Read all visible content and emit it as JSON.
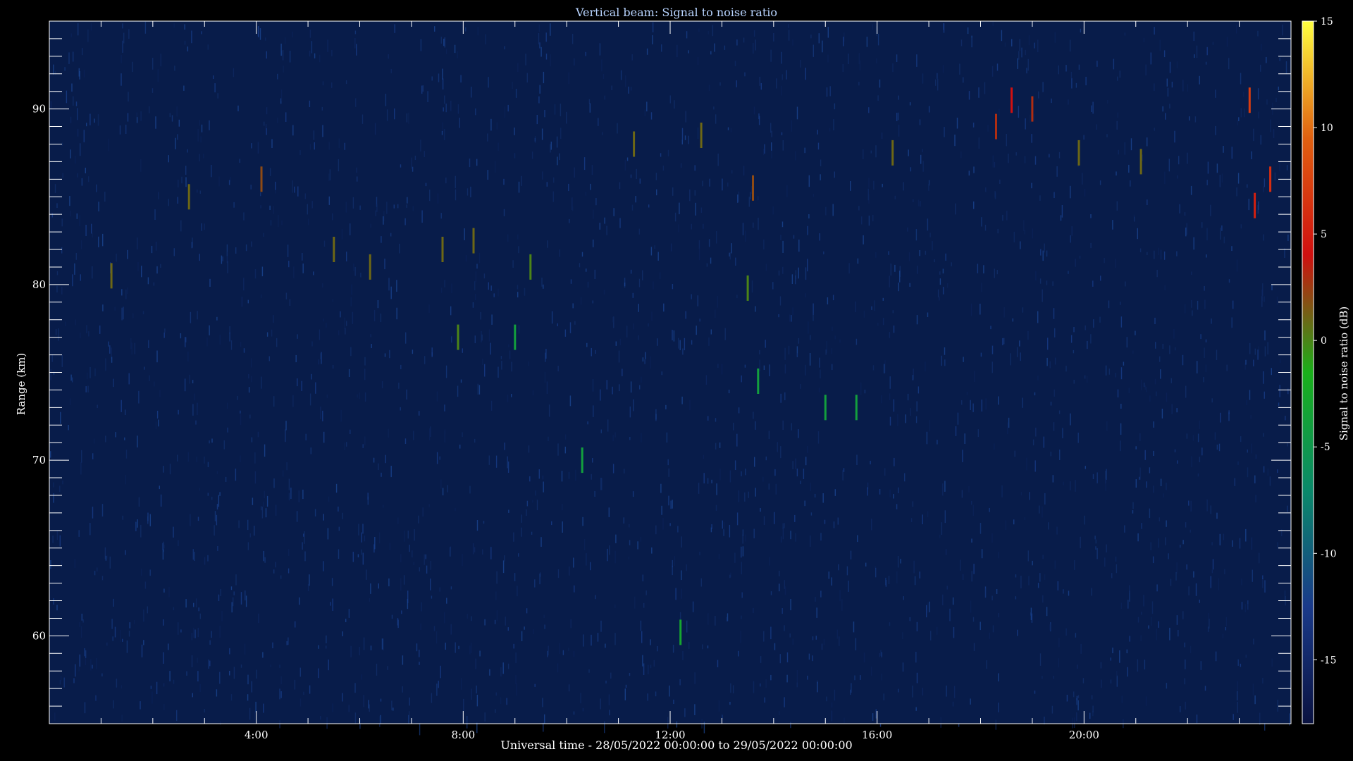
{
  "chart_data": {
    "type": "heatmap",
    "title": "Vertical beam: Signal to noise ratio",
    "xlabel": "Universal time - 28/05/2022 00:00:00 to 29/05/2022 00:00:00",
    "ylabel": "Range (km)",
    "colorbar_label": "Signal to noise ratio (dB)",
    "xlim_hours": [
      0,
      24
    ],
    "ylim_km": [
      55,
      95
    ],
    "clim_db": [
      -18,
      15
    ],
    "x_ticks": [
      {
        "hour": 4,
        "label": "4:00"
      },
      {
        "hour": 8,
        "label": "8:00"
      },
      {
        "hour": 12,
        "label": "12:00"
      },
      {
        "hour": 16,
        "label": "16:00"
      },
      {
        "hour": 20,
        "label": "20:00"
      }
    ],
    "y_ticks": [
      {
        "km": 60,
        "label": "60"
      },
      {
        "km": 70,
        "label": "70"
      },
      {
        "km": 80,
        "label": "80"
      },
      {
        "km": 90,
        "label": "90"
      }
    ],
    "colorbar_ticks": [
      {
        "db": 15,
        "label": "15"
      },
      {
        "db": 10,
        "label": "10"
      },
      {
        "db": 5,
        "label": "5"
      },
      {
        "db": 0,
        "label": "0"
      },
      {
        "db": -5,
        "label": "-5"
      },
      {
        "db": -10,
        "label": "-10"
      },
      {
        "db": -15,
        "label": "-15"
      }
    ],
    "colormap": [
      "#0a1240",
      "#1a3a8a",
      "#0a8a6a",
      "#1ab01a",
      "#d01010",
      "#e06010",
      "#ffff40"
    ],
    "background_color": "#081c4a",
    "echoes": [
      {
        "hour": 12.2,
        "km": 60.2,
        "db": -3
      },
      {
        "hour": 12.6,
        "km": 88.5,
        "db": 1
      },
      {
        "hour": 13.5,
        "km": 79.8,
        "db": 0
      },
      {
        "hour": 13.6,
        "km": 85.5,
        "db": 2
      },
      {
        "hour": 13.7,
        "km": 74.5,
        "db": -4
      },
      {
        "hour": 15.0,
        "km": 73.0,
        "db": -4
      },
      {
        "hour": 15.6,
        "km": 73.0,
        "db": -4
      },
      {
        "hour": 18.3,
        "km": 89.0,
        "db": 3
      },
      {
        "hour": 18.6,
        "km": 90.5,
        "db": 4
      },
      {
        "hour": 19.0,
        "km": 90.0,
        "db": 3
      },
      {
        "hour": 23.3,
        "km": 84.5,
        "db": 5
      },
      {
        "hour": 23.6,
        "km": 86.0,
        "db": 6
      },
      {
        "hour": 23.2,
        "km": 90.5,
        "db": 7
      },
      {
        "hour": 4.1,
        "km": 86.0,
        "db": 2
      },
      {
        "hour": 5.5,
        "km": 82.0,
        "db": 1
      },
      {
        "hour": 6.2,
        "km": 81.0,
        "db": 1
      },
      {
        "hour": 7.6,
        "km": 82.0,
        "db": 1
      },
      {
        "hour": 8.2,
        "km": 82.5,
        "db": 1
      },
      {
        "hour": 1.2,
        "km": 80.5,
        "db": 1
      },
      {
        "hour": 2.7,
        "km": 85.0,
        "db": 1
      },
      {
        "hour": 9.3,
        "km": 81.0,
        "db": 0
      },
      {
        "hour": 11.3,
        "km": 88.0,
        "db": 1
      },
      {
        "hour": 16.3,
        "km": 87.5,
        "db": 1
      },
      {
        "hour": 19.9,
        "km": 87.5,
        "db": 1
      },
      {
        "hour": 21.1,
        "km": 87.0,
        "db": 1
      },
      {
        "hour": 9.0,
        "km": 77.0,
        "db": -4
      },
      {
        "hour": 10.3,
        "km": 70.0,
        "db": -4
      },
      {
        "hour": 7.9,
        "km": 77.0,
        "db": 0
      }
    ]
  }
}
